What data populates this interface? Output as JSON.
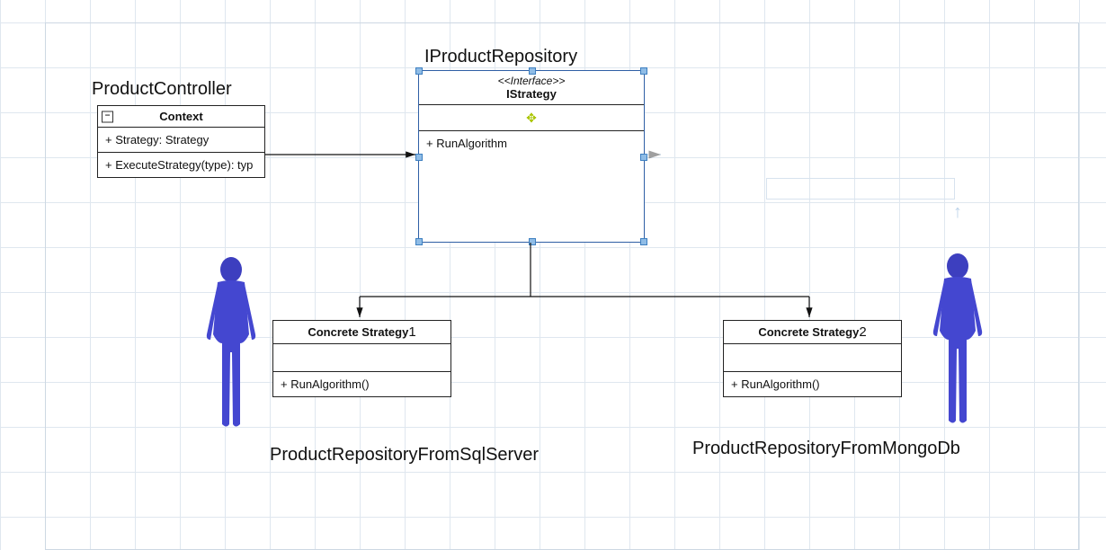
{
  "labels": {
    "context_title": "ProductController",
    "interface_title": "IProductRepository",
    "concrete1_title": "ProductRepositoryFromSqlServer",
    "concrete2_title": "ProductRepositoryFromMongoDb"
  },
  "context_box": {
    "header": "Context",
    "attr": "+ Strategy: Strategy",
    "method": "+ ExecuteStrategy(type): typ",
    "collapse": "−"
  },
  "interface_box": {
    "stereo": "<<Interface>>",
    "name": "IStrategy",
    "method": "+ RunAlgorithm"
  },
  "concrete1_box": {
    "header": "Concrete Strategy",
    "suffix": "1",
    "method": "+ RunAlgorithm()"
  },
  "concrete2_box": {
    "header": "Concrete Strategy",
    "suffix": "2",
    "method": "+ RunAlgorithm()"
  }
}
